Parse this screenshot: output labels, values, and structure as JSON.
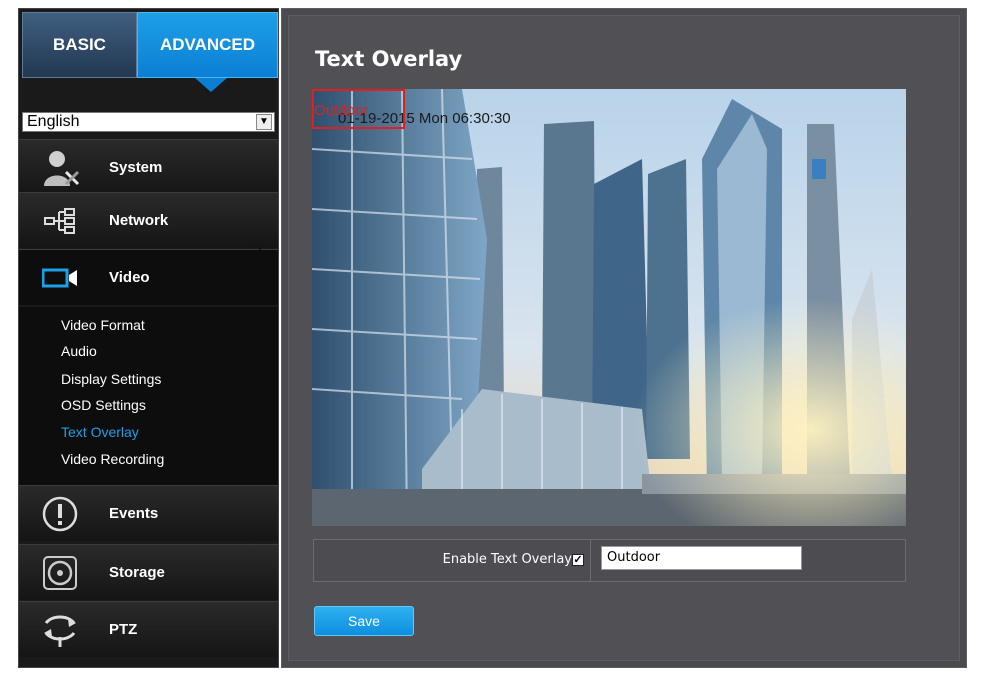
{
  "tabs": {
    "basic": "BASIC",
    "advanced": "ADVANCED"
  },
  "language": {
    "selected": "English"
  },
  "menu": [
    {
      "id": "system",
      "label": "System",
      "icon": "system-settings-icon"
    },
    {
      "id": "network",
      "label": "Network",
      "icon": "network-icon"
    },
    {
      "id": "video",
      "label": "Video",
      "icon": "video-camera-icon"
    },
    {
      "id": "events",
      "label": "Events",
      "icon": "alert-icon"
    },
    {
      "id": "storage",
      "label": "Storage",
      "icon": "storage-disc-icon"
    },
    {
      "id": "ptz",
      "label": "PTZ",
      "icon": "ptz-arrows-icon"
    }
  ],
  "video_submenu": [
    {
      "label": "Video Format",
      "active": false
    },
    {
      "label": "Audio",
      "active": false
    },
    {
      "label": "Display Settings",
      "active": false
    },
    {
      "label": "OSD Settings",
      "active": false
    },
    {
      "label": "Text Overlay",
      "active": true
    },
    {
      "label": "Video Recording",
      "active": false
    }
  ],
  "page": {
    "title": "Text Overlay",
    "preview": {
      "overlay_text": "Outdoor",
      "timestamp": "01-19-2015 Mon 06:30:30"
    },
    "enable_label": "Enable Text Overlay",
    "enabled": true,
    "overlay_value": "Outdoor",
    "save_label": "Save"
  },
  "colors": {
    "accent": "#1e9fe6",
    "sidebar_bg": "#1a1a1a",
    "main_bg": "#505055",
    "overlay_box": "#e02020"
  }
}
